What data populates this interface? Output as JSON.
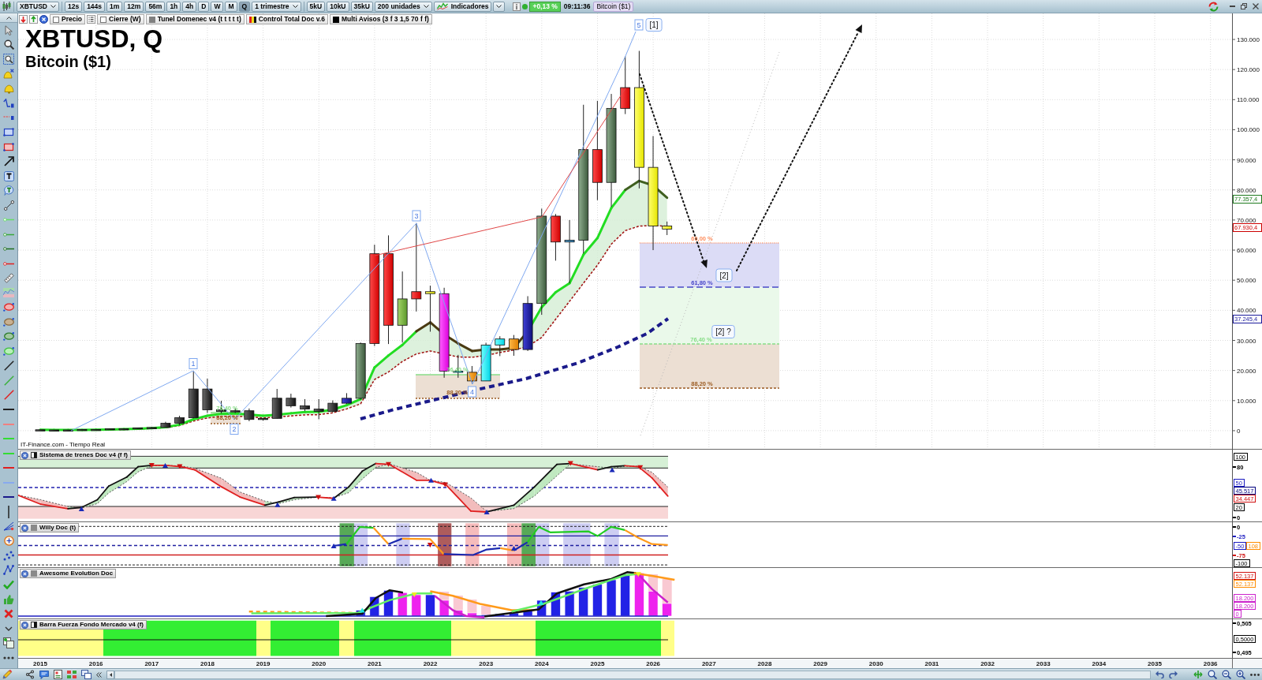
{
  "toolbar": {
    "symbol": "XBTUSD",
    "timeframes": [
      {
        "label": "12s",
        "selected": false
      },
      {
        "label": "144s",
        "selected": false
      },
      {
        "label": "1m",
        "selected": false
      },
      {
        "label": "12m",
        "selected": false
      },
      {
        "label": "56m",
        "selected": false
      },
      {
        "label": "1h",
        "selected": false
      },
      {
        "label": "4h",
        "selected": false
      },
      {
        "label": "D",
        "selected": false
      },
      {
        "label": "W",
        "selected": false
      },
      {
        "label": "M",
        "selected": false
      },
      {
        "label": "Q",
        "selected": true
      }
    ],
    "period": "1 trimestre",
    "units": [
      "5kU",
      "10kU",
      "35kU"
    ],
    "bars": "200 unidades",
    "indicators": "Indicadores",
    "change": "+0,13 %",
    "time": "09:11:36",
    "instrument": "Bitcoin ($1)"
  },
  "legend": [
    {
      "label": "Precio",
      "kind": "outline"
    },
    {
      "label": "Cierre (W)",
      "kind": "outline"
    },
    {
      "label": "Tunel Domenec v4 (t t t t t)",
      "kind": "solid",
      "color": "#808080"
    },
    {
      "label": "Control Total Doc v.6",
      "kind": "tricolor"
    },
    {
      "label": "Multi Avisos (3 f 3 1,5 70 f f)",
      "kind": "solid",
      "color": "#000000"
    }
  ],
  "chart": {
    "title": "XBTUSD, Q",
    "subtitle": "Bitcoin ($1)",
    "source": "IT-Finance.com - Tiempo Real",
    "wave_labels": [
      {
        "text": "1",
        "kind": "wave"
      },
      {
        "text": "2",
        "kind": "wave"
      },
      {
        "text": "3",
        "kind": "wave"
      },
      {
        "text": "4",
        "kind": "wave"
      },
      {
        "text": "5",
        "kind": "wave"
      },
      {
        "text": "[1]",
        "kind": "target"
      },
      {
        "text": "[2]",
        "kind": "target"
      },
      {
        "text": "[2] ?",
        "kind": "target"
      }
    ],
    "fib_zones": [
      {
        "levels": [
          {
            "label": "76,40 %",
            "color": "#88dd88"
          },
          {
            "label": "88,20 %",
            "color": "#9a5a20"
          }
        ]
      },
      {
        "levels": [
          {
            "label": "76,40 %",
            "color": "#88dd88"
          },
          {
            "label": "88,20 %",
            "color": "#9a5a20"
          }
        ]
      },
      {
        "levels": [
          {
            "label": "60,00 %",
            "color": "#ff9060"
          },
          {
            "label": "61,80 %",
            "color": "#4848c8"
          },
          {
            "label": "76,40 %",
            "color": "#88dd88"
          },
          {
            "label": "88,20 %",
            "color": "#9a5a20"
          }
        ]
      }
    ]
  },
  "price_axis": {
    "ticks": [
      "130.000",
      "120.000",
      "110.000",
      "100.000",
      "90.000",
      "80.000",
      "70.000",
      "60.000",
      "50.000",
      "40.000",
      "30.000",
      "20.000",
      "10.000",
      "0"
    ],
    "tags": [
      {
        "text": "77.357,4",
        "color": "#1f7a1f"
      },
      {
        "text": "67.930,4",
        "color": "#cc0000"
      },
      {
        "text": "37.245,4",
        "color": "#1a1a9c"
      }
    ]
  },
  "panels": [
    {
      "title": "Sistema de trenes Doc v4 (f f)",
      "kind": "trend",
      "half_filled": true,
      "axis": [
        {
          "text": "100",
          "color": "#000000",
          "boxed": true
        },
        {
          "text": "80",
          "color": "#000000",
          "boxed": false
        },
        {
          "text": "50",
          "color": "#1a1ac0",
          "boxed": true
        },
        {
          "text": "45.517",
          "color": "#000080",
          "boxed": true
        },
        {
          "text": "34.447",
          "color": "#d01010",
          "boxed": true
        },
        {
          "text": "20",
          "color": "#000000",
          "boxed": true
        },
        {
          "text": "0",
          "color": "#000000",
          "boxed": false
        }
      ]
    },
    {
      "title": "Willy Doc (t)",
      "kind": "willy",
      "half_filled": false,
      "axis": [
        {
          "text": "0",
          "color": "#000000",
          "boxed": false
        },
        {
          "text": "-25",
          "color": "#1a1ac0",
          "boxed": false
        },
        {
          "text": "-50",
          "color": "#1a1ac0",
          "boxed": true
        },
        {
          "text": "108",
          "color": "#ff8c00",
          "boxed": true
        },
        {
          "text": "-75",
          "color": "#d01010",
          "boxed": false
        },
        {
          "text": "-100",
          "color": "#000000",
          "boxed": true
        }
      ]
    },
    {
      "title": "Awesome Evolution Doc",
      "kind": "awesome",
      "half_filled": false,
      "axis": [
        {
          "text": "52.137",
          "color": "#d01010",
          "boxed": true
        },
        {
          "text": "52.137",
          "color": "#ff8c00",
          "boxed": true
        },
        {
          "text": "18.200",
          "color": "#cc22cc",
          "boxed": true
        },
        {
          "text": "18.200",
          "color": "#cc22cc",
          "boxed": true
        },
        {
          "text": "0",
          "color": "#cc22cc",
          "boxed": true
        }
      ]
    },
    {
      "title": "Barra Fuerza Fondo Mercado v4 (f)",
      "kind": "strength",
      "half_filled": true,
      "axis": [
        {
          "text": "0,505",
          "color": "#000000",
          "boxed": false
        },
        {
          "text": "0,5000",
          "color": "#000000",
          "boxed": true
        },
        {
          "text": "0,495",
          "color": "#000000",
          "boxed": false
        }
      ]
    }
  ],
  "years": [
    "2015",
    "2016",
    "2017",
    "2018",
    "2019",
    "2020",
    "2021",
    "2022",
    "2023",
    "2024",
    "2025",
    "2026",
    "2027",
    "2028",
    "2029",
    "2030",
    "2031",
    "2032",
    "2033",
    "2034",
    "2035",
    "2036"
  ]
}
